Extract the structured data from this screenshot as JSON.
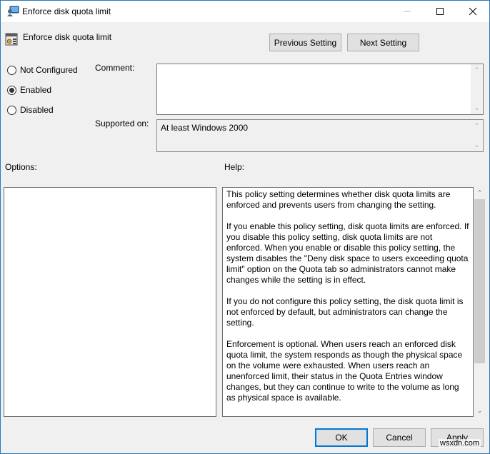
{
  "window": {
    "title": "Enforce disk quota limit",
    "controls": {
      "minimize": "—",
      "maximize": "☐",
      "close": "✕"
    }
  },
  "header": {
    "setting_name": "Enforce disk quota limit",
    "previous_label": "Previous Setting",
    "next_label": "Next Setting"
  },
  "state": {
    "options": [
      {
        "label": "Not Configured",
        "selected": false
      },
      {
        "label": "Enabled",
        "selected": true
      },
      {
        "label": "Disabled",
        "selected": false
      }
    ]
  },
  "comment": {
    "label": "Comment:",
    "value": ""
  },
  "supported": {
    "label": "Supported on:",
    "value": "At least Windows 2000"
  },
  "options_panel": {
    "label": "Options:"
  },
  "help_panel": {
    "label": "Help:",
    "text": "This policy setting determines whether disk quota limits are enforced and prevents users from changing the setting.\n\nIf you enable this policy setting, disk quota limits are enforced. If you disable this policy setting, disk quota limits are not enforced. When you enable or disable this policy setting, the system disables the \"Deny disk space to users exceeding quota limit\" option on the Quota tab so administrators cannot make changes while the setting is in effect.\n\nIf you do not configure this policy setting, the disk quota limit is not enforced by default, but administrators can change the setting.\n\nEnforcement is optional. When users reach an enforced disk quota limit, the system responds as though the physical space on the volume were exhausted. When users reach an unenforced limit, their status in the Quota Entries window changes, but they can continue to write to the volume as long as physical space is available."
  },
  "footer": {
    "ok_label": "OK",
    "cancel_label": "Cancel",
    "apply_label": "Apply"
  },
  "watermark": "wsxdn.com",
  "icons": {
    "scroll_up": "⌃",
    "scroll_down": "⌄"
  },
  "colors": {
    "accent": "#0078d7",
    "window_border": "#2b79b8"
  }
}
